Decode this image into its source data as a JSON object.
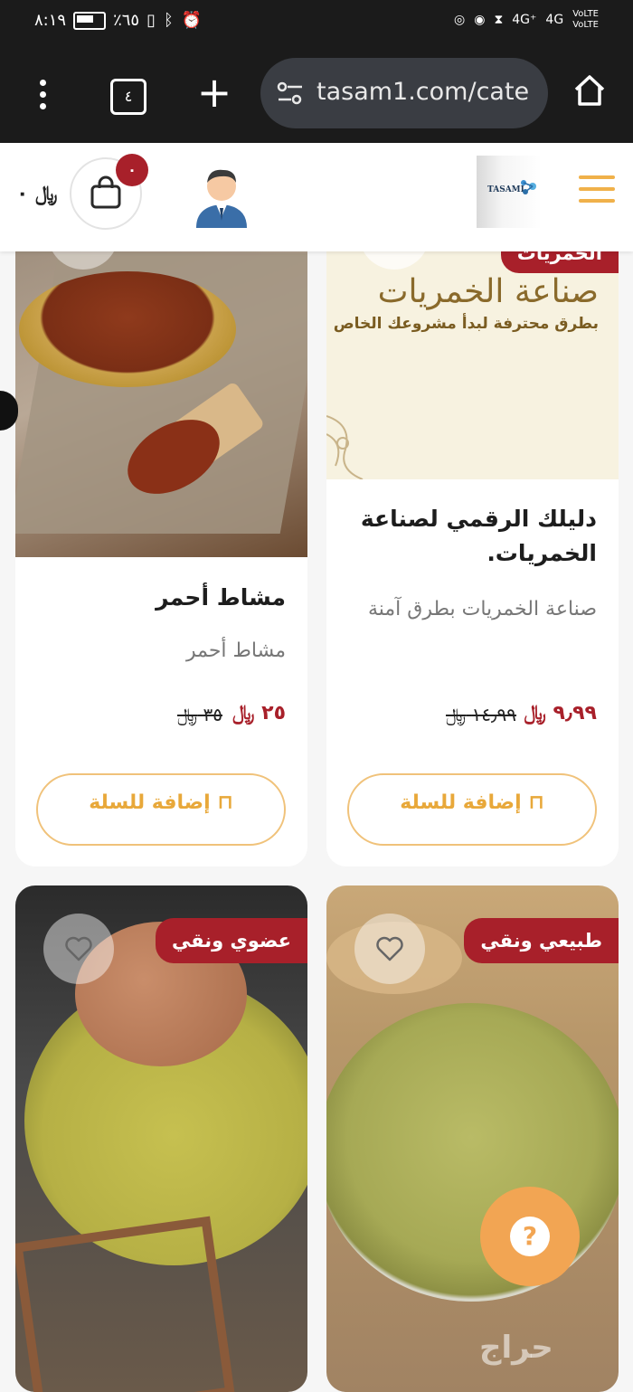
{
  "status_bar": {
    "time": "٨:١٩",
    "battery_text": "٪٦٥",
    "network_1": "4G⁺",
    "network_2": "4G",
    "volte_1": "VoLTE",
    "volte_2": "VoLTE"
  },
  "browser": {
    "tab_count": "٤",
    "url": "tasam1.com/cate"
  },
  "header": {
    "cart_total": "٠",
    "currency_symbol": "﷼",
    "cart_count": "٠",
    "logo_text": "TASAMI"
  },
  "products": [
    {
      "image_text_title": "صناعة الخمريات",
      "image_text_sub": "بطرق محترفة لبدأ مشروعك الخاص",
      "badge_top": "الخمريات",
      "title": "دليلك الرقمي لصناعة الخمريات.",
      "description": "صناعة الخمريات بطرق آمنة",
      "price": "٩٫٩٩",
      "old_price": "١٤٫٩٩",
      "add_label": "إضافة للسلة"
    },
    {
      "title": "مشاط أحمر",
      "description": "مشاط أحمر",
      "price": "٢٥",
      "old_price": "٣٥",
      "add_label": "إضافة للسلة"
    },
    {
      "badge": "طبيعي ونقي"
    },
    {
      "badge": "عضوي ونقي"
    }
  ],
  "help": {
    "label": "?"
  },
  "watermark": "حراج",
  "colors": {
    "accent": "#a8202a",
    "button_border": "#f0c27a",
    "button_text": "#e8a83a",
    "fab": "#f2a553"
  }
}
